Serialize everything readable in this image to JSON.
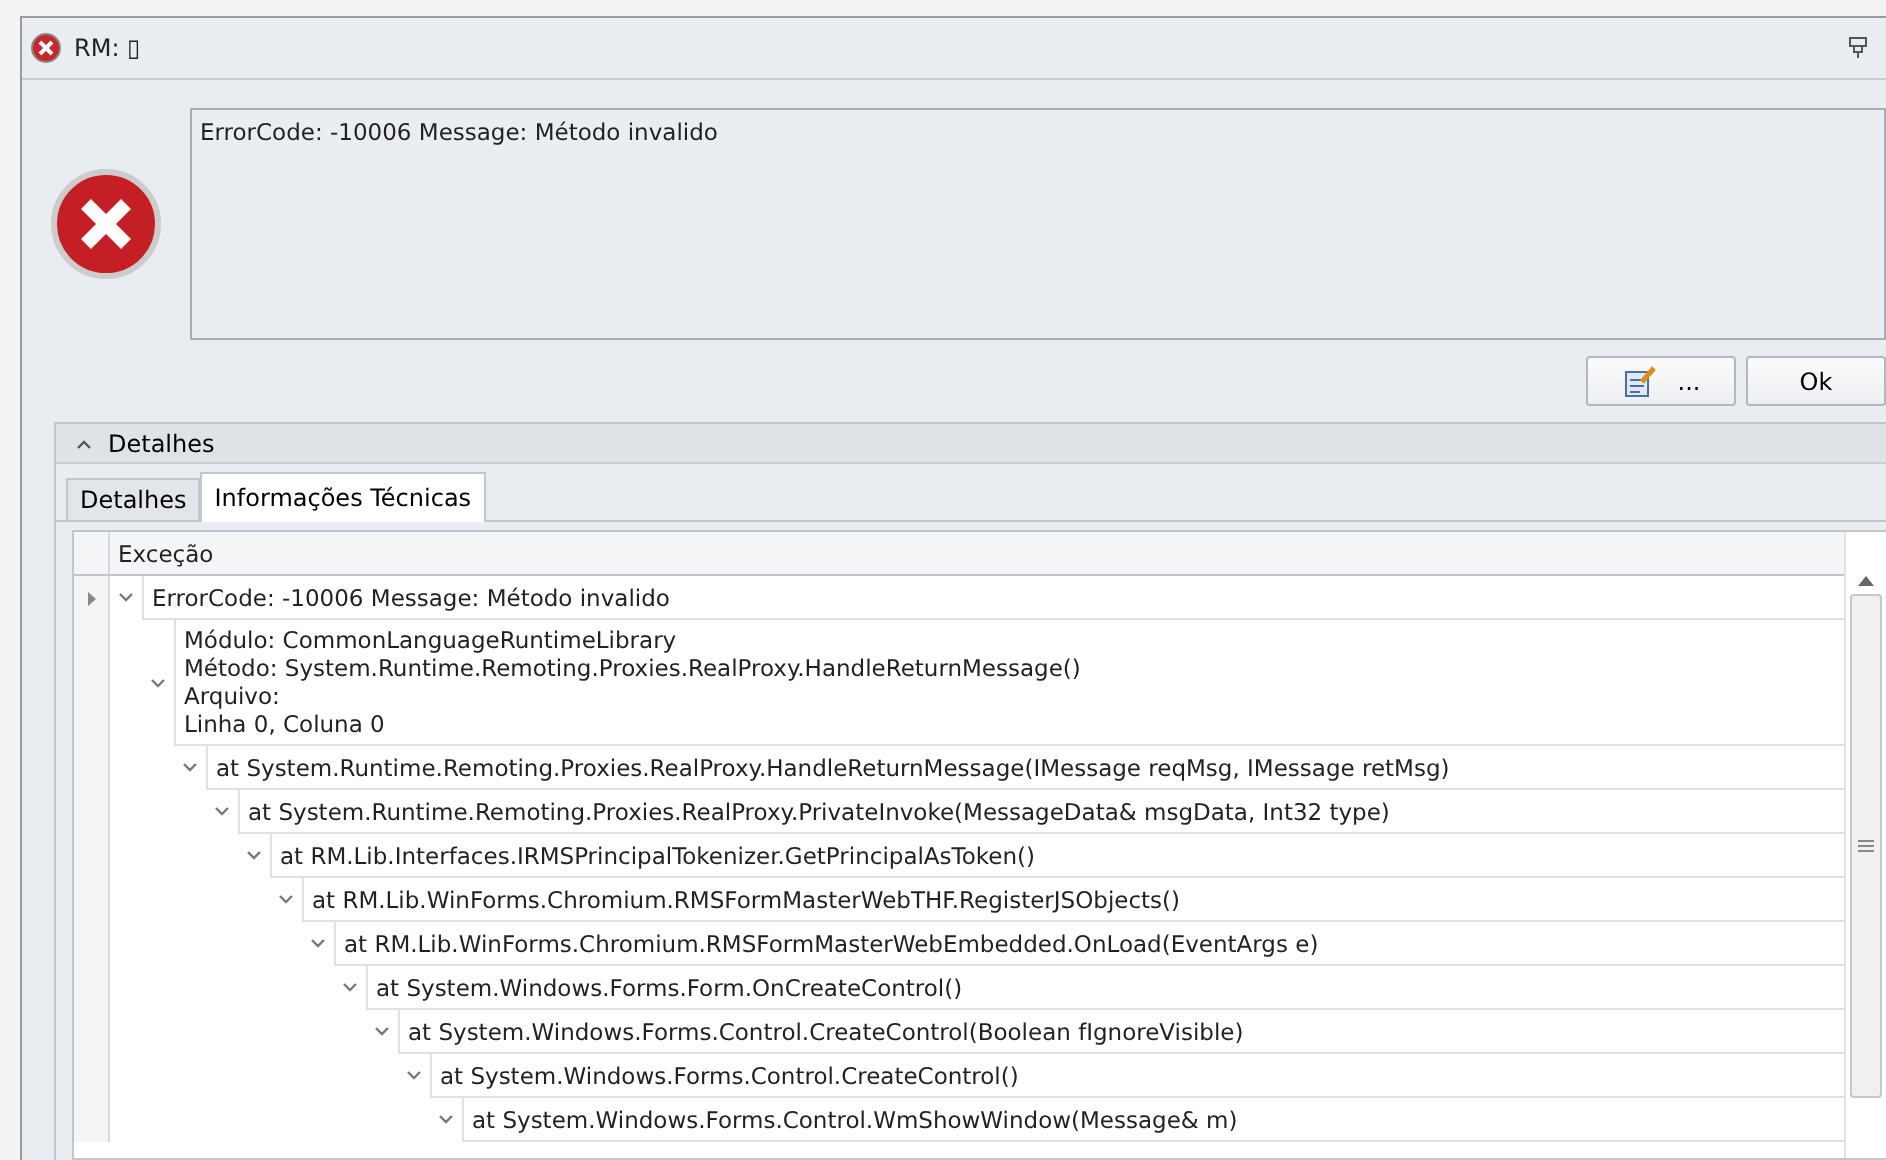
{
  "window": {
    "title": "RM: ▯"
  },
  "message": {
    "text": "ErrorCode: -10006 Message: Método invalido"
  },
  "buttons": [
    {
      "kind": "icon",
      "label": "..."
    },
    {
      "kind": "text",
      "label": "Ok"
    }
  ],
  "details_group": {
    "title": "Detalhes",
    "expanded": true
  },
  "tabs": [
    {
      "label": "Detalhes",
      "selected": false
    },
    {
      "label": "Informações Técnicas",
      "selected": true
    }
  ],
  "grid": {
    "column": "Exceção",
    "rows": [
      {
        "text": "ErrorCode: -10006 Message: Método invalido",
        "current": true,
        "expanded": true,
        "children": [
          {
            "lines": [
              "Módulo: CommonLanguageRuntimeLibrary",
              "Método: System.Runtime.Remoting.Proxies.RealProxy.HandleReturnMessage()",
              "Arquivo:",
              "Linha 0, Coluna 0"
            ],
            "current": false,
            "expanded": true,
            "children": [
              {
                "text": "at System.Runtime.Remoting.Proxies.RealProxy.HandleReturnMessage(IMessage reqMsg, IMessage retMsg)",
                "current": false,
                "expanded": true,
                "children": [
                  {
                    "text": "at System.Runtime.Remoting.Proxies.RealProxy.PrivateInvoke(MessageData& msgData, Int32 type)",
                    "current": false,
                    "expanded": true,
                    "children": [
                      {
                        "text": "at RM.Lib.Interfaces.IRMSPrincipalTokenizer.GetPrincipalAsToken()",
                        "current": false,
                        "expanded": true,
                        "children": [
                          {
                            "text": "at RM.Lib.WinForms.Chromium.RMSFormMasterWebTHF.RegisterJSObjects()",
                            "current": false,
                            "expanded": true,
                            "children": [
                              {
                                "text": "at RM.Lib.WinForms.Chromium.RMSFormMasterWebEmbedded.OnLoad(EventArgs e)",
                                "current": false,
                                "expanded": true,
                                "children": [
                                  {
                                    "text": "at System.Windows.Forms.Form.OnCreateControl()",
                                    "current": false,
                                    "expanded": true,
                                    "children": [
                                      {
                                        "text": "at System.Windows.Forms.Control.CreateControl(Boolean fIgnoreVisible)",
                                        "current": false,
                                        "expanded": true,
                                        "children": [
                                          {
                                            "text": "at System.Windows.Forms.Control.CreateControl()",
                                            "current": false,
                                            "expanded": true,
                                            "children": [
                                              {
                                                "text": "at System.Windows.Forms.Control.WmShowWindow(Message& m)",
                                                "current": false,
                                                "expanded": true
                                              }
                                            ]
                                          }
                                        ]
                                      }
                                    ]
                                  }
                                ]
                              }
                            ]
                          }
                        ]
                      }
                    ]
                  }
                ]
              }
            ]
          }
        ]
      }
    ]
  }
}
